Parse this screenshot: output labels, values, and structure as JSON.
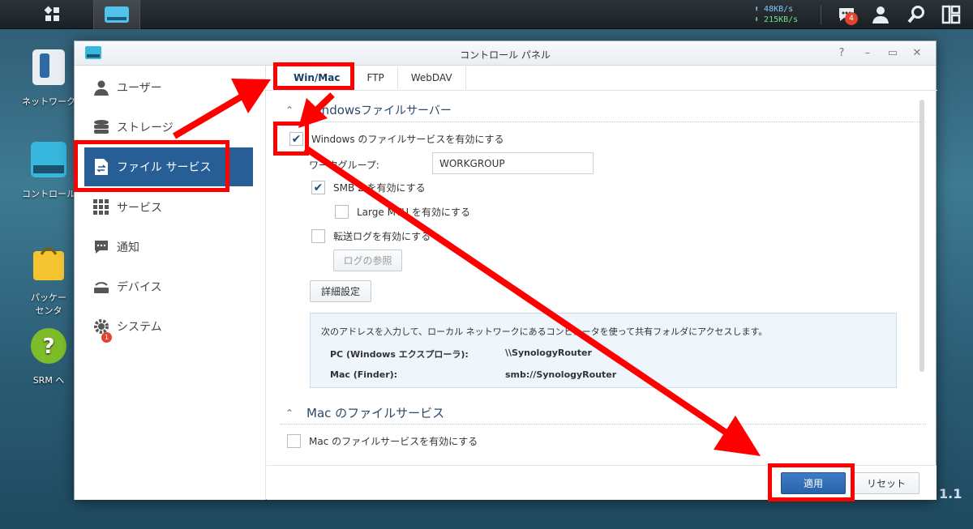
{
  "taskbar": {
    "net_up": "48KB/s",
    "net_down": "215KB/s",
    "notification_count": "4"
  },
  "desktop": {
    "icons": [
      {
        "label": "ネットワーク"
      },
      {
        "label": "コントロール"
      },
      {
        "label": "パッケー\nセンタ"
      },
      {
        "label": "SRM へ"
      }
    ],
    "version_text": "1.1"
  },
  "window": {
    "title": "コントロール パネル",
    "controls": [
      "?",
      "–",
      "▭",
      "✕"
    ]
  },
  "sidebar": {
    "items": [
      {
        "label": "ユーザー",
        "icon": "user-icon"
      },
      {
        "label": "ストレージ",
        "icon": "storage-icon"
      },
      {
        "label": "ファイル サービス",
        "icon": "file-service-icon",
        "active": true
      },
      {
        "label": "サービス",
        "icon": "service-grid-icon"
      },
      {
        "label": "通知",
        "icon": "notification-icon"
      },
      {
        "label": "デバイス",
        "icon": "device-icon"
      },
      {
        "label": "システム",
        "icon": "system-gear-icon",
        "badge": "1"
      }
    ]
  },
  "tabs": [
    {
      "label": "Win/Mac",
      "active": true
    },
    {
      "label": "FTP"
    },
    {
      "label": "WebDAV"
    }
  ],
  "windows_section": {
    "title_a": "Win",
    "title_b": "dows",
    "title_c": " ファイルサーバー",
    "enable_label": "Windows のファイルサービスを有効にする",
    "enable_checked": true,
    "workgroup_label": "ワークグループ:",
    "workgroup_value": "WORKGROUP",
    "smb_label": "SMB 2 を有効にする",
    "smb_checked": true,
    "large_mtu_label": "Large MTU を有効にする",
    "large_mtu_checked": false,
    "transfer_log_label": "転送ログを有効にする",
    "transfer_log_checked": false,
    "view_log_button": "ログの参照",
    "advanced_button": "詳細設定",
    "info_text": "次のアドレスを入力して、ローカル ネットワークにあるコンピュータを使って共有フォルダにアクセスします。",
    "pc_label": "PC (Windows エクスプローラ):",
    "pc_value": "\\\\SynologyRouter",
    "mac_label": "Mac (Finder):",
    "mac_value": "smb://SynologyRouter"
  },
  "mac_section": {
    "title": "Mac のファイルサービス",
    "enable_label": "Mac のファイルサービスを有効にする",
    "enable_checked": false
  },
  "footer": {
    "apply_label": "適用",
    "reset_label": "リセット"
  },
  "colors": {
    "accent": "#275e96",
    "highlight": "#ff0000"
  }
}
